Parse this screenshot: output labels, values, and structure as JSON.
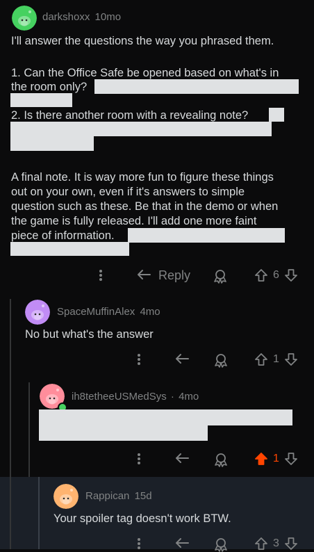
{
  "comments": [
    {
      "username": "darkshoxx",
      "age": "10mo",
      "avatar_color": "#46d160",
      "text": {
        "line1": "I'll answer the questions the way you phrased them.",
        "q1_a": "1. Can the Office Safe be opened based on what's in",
        "q1_b": "the room only?",
        "q2": "2. Is there another room with a revealing note?",
        "note1": "A final note. It is way more fun to figure these things",
        "note2": "out on your own, even if it's answers to simple",
        "note3": "question such as these. Be that in the demo or when",
        "note4": "the game is fully released. I'll add one more faint",
        "note5": "piece of information."
      },
      "reply_label": "Reply",
      "votes": "6"
    },
    {
      "username": "SpaceMuffinAlex",
      "age": "4mo",
      "avatar_color": "#c18cf5",
      "text": "No but what's the answer",
      "votes": "1"
    },
    {
      "username": "ih8tetheeUSMedSys",
      "separator": "·",
      "age": "4mo",
      "avatar_color": "#ff8d9b",
      "online_color": "#46d160",
      "votes": "1",
      "upvoted": true,
      "upvote_color": "#ff4500"
    },
    {
      "username": "Rappican",
      "age": "15d",
      "avatar_color": "#ffb470",
      "text": "Your spoiler tag doesn't work BTW.",
      "votes": "3"
    }
  ]
}
